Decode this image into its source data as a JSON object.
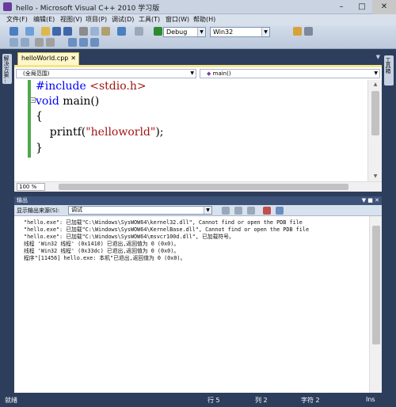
{
  "window": {
    "title": "hello - Microsoft Visual C++ 2010 学习版"
  },
  "menu": [
    "文件(F)",
    "编辑(E)",
    "视图(V)",
    "项目(P)",
    "调试(D)",
    "工具(T)",
    "窗口(W)",
    "帮助(H)"
  ],
  "toolbar": {
    "config": "Debug",
    "platform": "Win32"
  },
  "side": {
    "left_tab": "解决方案…",
    "right_tab": "工具箱"
  },
  "editor": {
    "tab_label": "helloWorld.cpp",
    "scope_combo": "(全局范围)",
    "member_combo": "main()",
    "code": {
      "line1_pp": "#include",
      "line1_inc": " <stdio.h>",
      "line2_kw": "void",
      "line2_rest": " main()",
      "line3": "{",
      "line4_a": "    printf(",
      "line4_str": "\"helloworld\"",
      "line4_b": ");",
      "line5": "}"
    },
    "zoom": "100 %"
  },
  "output": {
    "title": "输出",
    "source_label": "显示输出来源(S):",
    "source_value": "调试",
    "lines": [
      "\"hello.exe\": 已加载\"C:\\Windows\\SysWOW64\\kernel32.dll\", Cannot find or open the PDB file",
      "\"hello.exe\": 已加载\"C:\\Windows\\SysWOW64\\KernelBase.dll\", Cannot find or open the PDB file",
      "\"hello.exe\": 已加载\"C:\\Windows\\SysWOW64\\msvcr100d.dll\", 已加载符号。",
      "线程 'Win32 线程' (0x1410) 已退出,返回值为 0 (0x0)。",
      "线程 'Win32 线程' (0x33dc) 已退出,返回值为 0 (0x0)。",
      "程序\"[11456] hello.exe: 本机\"已退出,返回值为 0 (0x0)。"
    ]
  },
  "status": {
    "ready": "就绪",
    "line": "行 5",
    "col": "列 2",
    "char": "字符 2",
    "mode": "Ins"
  },
  "colors": {
    "frame": "#2d3d5c",
    "tab_active": "#fff7c9",
    "keyword": "#0000ff",
    "string": "#a31515"
  }
}
